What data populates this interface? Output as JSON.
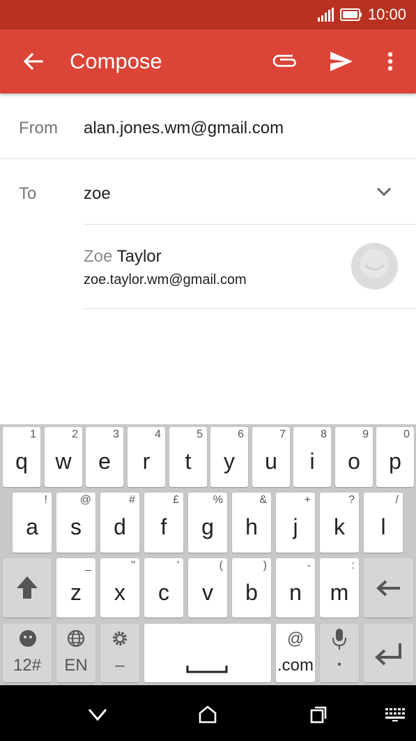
{
  "status_bar": {
    "time": "10:00"
  },
  "app_bar": {
    "title": "Compose"
  },
  "compose": {
    "from_label": "From",
    "from_value": "alan.jones.wm@gmail.com",
    "to_label": "To",
    "to_value": "zoe"
  },
  "suggestion": {
    "name_match": "Zoe",
    "name_rest": " Taylor",
    "email": "zoe.taylor.wm@gmail.com"
  },
  "keyboard": {
    "row1": [
      {
        "k": "q",
        "s": "1"
      },
      {
        "k": "w",
        "s": "2"
      },
      {
        "k": "e",
        "s": "3"
      },
      {
        "k": "r",
        "s": "4"
      },
      {
        "k": "t",
        "s": "5"
      },
      {
        "k": "y",
        "s": "6"
      },
      {
        "k": "u",
        "s": "7"
      },
      {
        "k": "i",
        "s": "8"
      },
      {
        "k": "o",
        "s": "9"
      },
      {
        "k": "p",
        "s": "0"
      }
    ],
    "row2": [
      {
        "k": "a",
        "s": "!"
      },
      {
        "k": "s",
        "s": "@"
      },
      {
        "k": "d",
        "s": "#"
      },
      {
        "k": "f",
        "s": "£"
      },
      {
        "k": "g",
        "s": "%"
      },
      {
        "k": "h",
        "s": "&"
      },
      {
        "k": "j",
        "s": "+"
      },
      {
        "k": "k",
        "s": "?"
      },
      {
        "k": "l",
        "s": "/"
      }
    ],
    "row3": [
      {
        "k": "z",
        "s": "_"
      },
      {
        "k": "x",
        "s": "\""
      },
      {
        "k": "c",
        "s": "'"
      },
      {
        "k": "v",
        "s": "("
      },
      {
        "k": "b",
        "s": ")"
      },
      {
        "k": "n",
        "s": "-"
      },
      {
        "k": "m",
        "s": ":"
      }
    ],
    "symbols_label": "12#",
    "language_label": "EN",
    "settings_sub": "–",
    "at_label": "@",
    "dotcom_label": ".com",
    "mic_sub": "•"
  }
}
